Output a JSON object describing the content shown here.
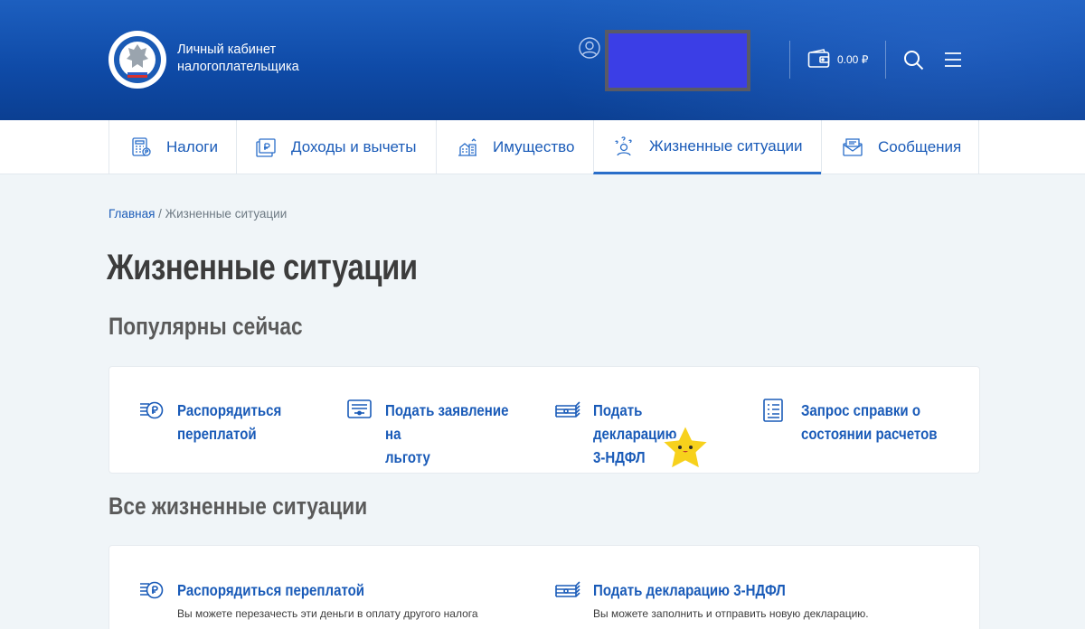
{
  "header": {
    "brand_line1": "Личный кабинет",
    "brand_line2": "налогоплательщика",
    "balance": "0.00 ₽",
    "icons": [
      "emblem-logo",
      "user-icon",
      "wallet-icon",
      "search-icon",
      "menu-icon"
    ],
    "colors": {
      "header_bg": "#0f4ba8",
      "accent": "#1a5bb8"
    }
  },
  "nav": {
    "items": [
      {
        "label": "Налоги",
        "icon": "calculator-icon"
      },
      {
        "label": "Доходы и вычеты",
        "icon": "income-icon"
      },
      {
        "label": "Имущество",
        "icon": "property-icon"
      },
      {
        "label": "Жизненные ситуации",
        "icon": "life-situations-icon",
        "active": true
      },
      {
        "label": "Сообщения",
        "icon": "envelope-icon"
      }
    ]
  },
  "breadcrumb": {
    "home": "Главная",
    "separator": " / ",
    "current": "Жизненные ситуации"
  },
  "page_title": "Жизненные ситуации",
  "popular": {
    "heading": "Популярны сейчас",
    "tiles": [
      {
        "label_line1": "Распорядиться",
        "label_line2": "переплатой",
        "icon": "ruble-coins-icon"
      },
      {
        "label_line1": "Подать заявление на",
        "label_line2": "льготу",
        "icon": "document-card-icon"
      },
      {
        "label_line1": "Подать декларацию",
        "label_line2": "3-НДФЛ",
        "icon": "banknotes-icon"
      },
      {
        "label_line1": "Запрос справки о",
        "label_line2": "состоянии расчетов",
        "icon": "checklist-icon"
      }
    ]
  },
  "all": {
    "heading": "Все жизненные ситуации",
    "items": [
      {
        "label": "Распорядиться переплатой",
        "desc": "Вы можете перезачесть эти деньги в оплату другого налога",
        "icon": "ruble-coins-icon"
      },
      {
        "label": "Подать декларацию 3-НДФЛ",
        "desc": "Вы можете заполнить и отправить новую декларацию.",
        "icon": "banknotes-icon"
      }
    ]
  }
}
